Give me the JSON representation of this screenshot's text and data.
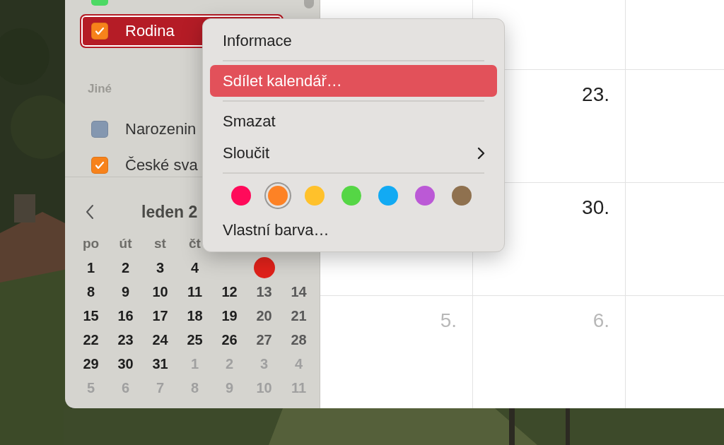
{
  "sidebar": {
    "top_item": {
      "color": "#4cd964"
    },
    "selected_item": {
      "label": "Rodina",
      "checked": true,
      "color": "#f7821b",
      "selected": true
    },
    "section": "Jiné",
    "items": [
      {
        "label": "Narozenin",
        "checked": false,
        "color": "#8497b0"
      },
      {
        "label": "České sva",
        "checked": true,
        "color": "#f7821b"
      }
    ]
  },
  "mini_calendar": {
    "title": "leden 2",
    "weekdays": [
      "po",
      "út",
      "st",
      "čt"
    ],
    "today_marker": true,
    "weeks": [
      [
        {
          "day": "1",
          "kind": "weekday"
        },
        {
          "day": "2",
          "kind": "weekday"
        },
        {
          "day": "3",
          "kind": "weekday"
        },
        {
          "day": "4",
          "kind": "weekday"
        }
      ],
      [
        {
          "day": "8",
          "kind": "weekday"
        },
        {
          "day": "9",
          "kind": "weekday"
        },
        {
          "day": "10",
          "kind": "weekday"
        },
        {
          "day": "11",
          "kind": "weekday"
        },
        {
          "day": "12",
          "kind": "weekday"
        },
        {
          "day": "13",
          "kind": "weekend"
        },
        {
          "day": "14",
          "kind": "weekend"
        }
      ],
      [
        {
          "day": "15",
          "kind": "weekday"
        },
        {
          "day": "16",
          "kind": "weekday"
        },
        {
          "day": "17",
          "kind": "weekday"
        },
        {
          "day": "18",
          "kind": "weekday"
        },
        {
          "day": "19",
          "kind": "weekday"
        },
        {
          "day": "20",
          "kind": "weekend"
        },
        {
          "day": "21",
          "kind": "weekend"
        }
      ],
      [
        {
          "day": "22",
          "kind": "weekday"
        },
        {
          "day": "23",
          "kind": "weekday"
        },
        {
          "day": "24",
          "kind": "weekday"
        },
        {
          "day": "25",
          "kind": "weekday"
        },
        {
          "day": "26",
          "kind": "weekday"
        },
        {
          "day": "27",
          "kind": "weekend"
        },
        {
          "day": "28",
          "kind": "weekend"
        }
      ],
      [
        {
          "day": "29",
          "kind": "weekday"
        },
        {
          "day": "30",
          "kind": "weekday"
        },
        {
          "day": "31",
          "kind": "weekday"
        },
        {
          "day": "1",
          "kind": "other"
        },
        {
          "day": "2",
          "kind": "other"
        },
        {
          "day": "3",
          "kind": "other"
        },
        {
          "day": "4",
          "kind": "other"
        }
      ],
      [
        {
          "day": "5",
          "kind": "other"
        },
        {
          "day": "6",
          "kind": "other"
        },
        {
          "day": "7",
          "kind": "other"
        },
        {
          "day": "8",
          "kind": "other"
        },
        {
          "day": "9",
          "kind": "other"
        },
        {
          "day": "10",
          "kind": "other"
        },
        {
          "day": "11",
          "kind": "other"
        }
      ]
    ]
  },
  "month_grid": {
    "rows": [
      [
        {
          "kind": "empty"
        },
        {
          "kind": "empty"
        },
        {
          "kind": "empty"
        }
      ],
      [
        {
          "kind": "empty"
        },
        {
          "kind": "day",
          "day": "23.",
          "dimmed": false
        },
        {
          "kind": "empty"
        }
      ],
      [
        {
          "kind": "empty"
        },
        {
          "kind": "day",
          "day": "30.",
          "dimmed": false
        },
        {
          "kind": "empty"
        }
      ],
      [
        {
          "kind": "day",
          "day": "5.",
          "dimmed": true
        },
        {
          "kind": "day",
          "day": "6.",
          "dimmed": true
        },
        {
          "kind": "empty"
        }
      ]
    ]
  },
  "context_menu": {
    "items": [
      {
        "kind": "item",
        "label": "Informace",
        "selected": false
      },
      {
        "kind": "separator"
      },
      {
        "kind": "item",
        "label": "Sdílet kalendář…",
        "selected": true
      },
      {
        "kind": "separator"
      },
      {
        "kind": "item",
        "label": "Smazat",
        "selected": false
      },
      {
        "kind": "submenu",
        "label": "Sloučit",
        "selected": false
      },
      {
        "kind": "separator"
      },
      {
        "kind": "colors",
        "colors": [
          {
            "color": "#ff0a5a",
            "selected": false
          },
          {
            "color": "#fd8225",
            "selected": true
          },
          {
            "color": "#ffc12b",
            "selected": false
          },
          {
            "color": "#55d645",
            "selected": false
          },
          {
            "color": "#12aaf3",
            "selected": false
          },
          {
            "color": "#bb59d6",
            "selected": false
          },
          {
            "color": "#8f714f",
            "selected": false
          }
        ]
      },
      {
        "kind": "item",
        "label": "Vlastní barva…",
        "selected": false
      }
    ]
  }
}
